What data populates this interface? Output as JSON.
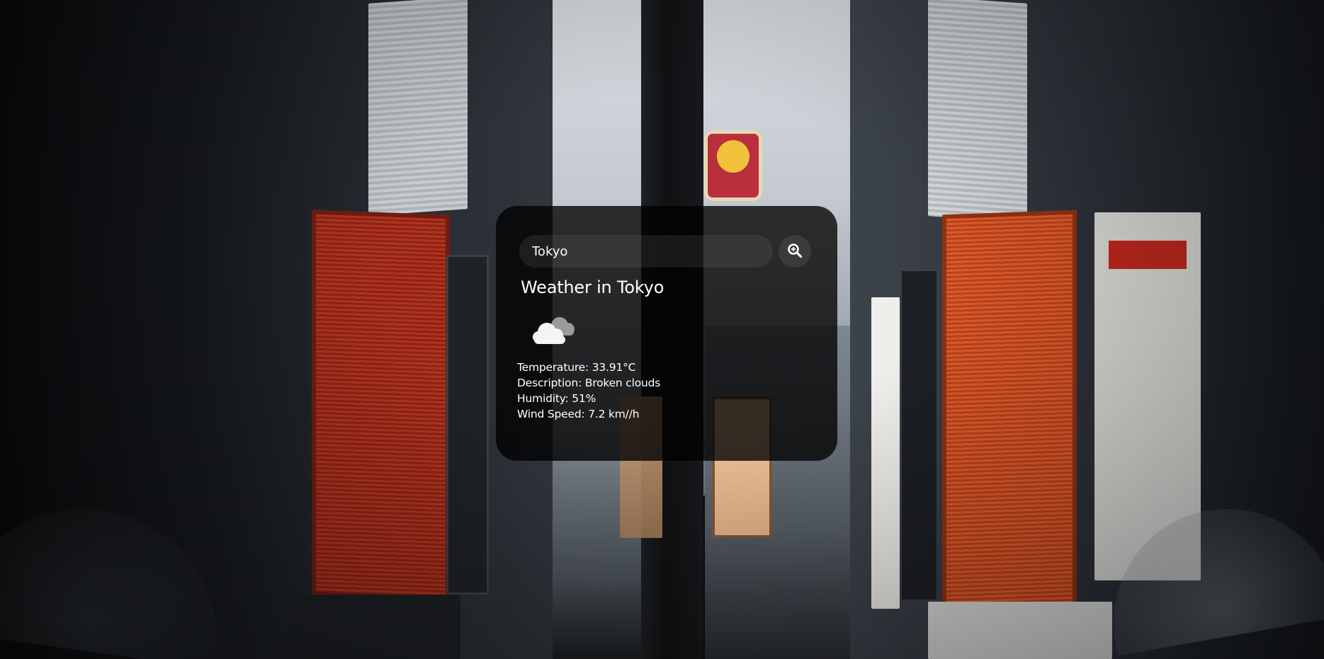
{
  "search": {
    "value": "Tokyo",
    "placeholder": "Search"
  },
  "weather": {
    "title": "Weather in Tokyo",
    "icon": "broken-clouds-icon",
    "temperature": "Temperature: 33.91°C",
    "description": "Description: Broken clouds",
    "humidity": "Humidity: 51%",
    "wind_speed": "Wind Speed: 7.2 km//h"
  },
  "colors": {
    "card_background": "#000000",
    "text": "#ffffff",
    "input_background": "#7c7c7c"
  }
}
